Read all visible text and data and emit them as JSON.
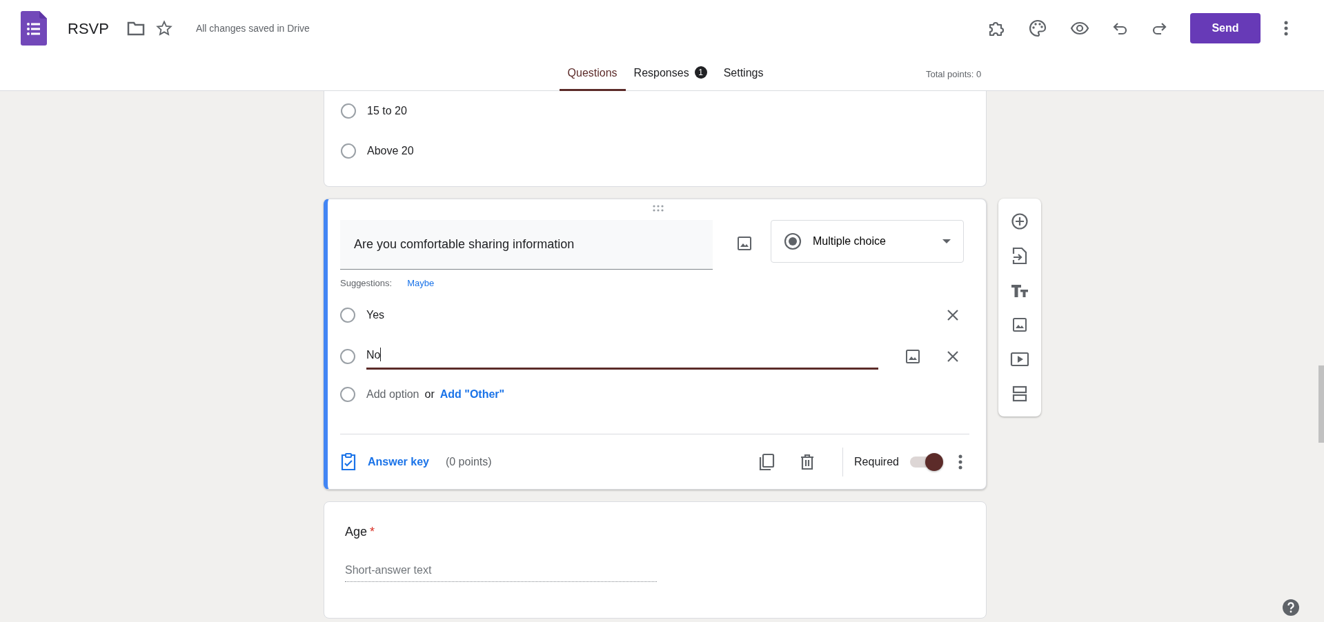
{
  "header": {
    "title": "RSVP",
    "save_status": "All changes saved in Drive",
    "send_label": "Send"
  },
  "tabs": [
    {
      "label": "Questions",
      "selected": true
    },
    {
      "label": "Responses",
      "selected": false,
      "badge": "1"
    },
    {
      "label": "Settings",
      "selected": false
    }
  ],
  "total_points": "Total points: 0",
  "previous_question": {
    "options": [
      {
        "label": "15 to 20",
        "selected": false
      },
      {
        "label": "Above 20",
        "selected": false
      }
    ]
  },
  "active_question": {
    "title": "Are you comfortable sharing information",
    "type": "Multiple choice",
    "suggestions_label": "Suggestions:",
    "suggestions": [
      "Maybe"
    ],
    "options": [
      {
        "label": "Yes",
        "focused": false,
        "selected": false
      },
      {
        "label": "No",
        "focused": true,
        "selected": false
      }
    ],
    "add_option": "Add option",
    "or": "or",
    "add_other": "Add \"Other\"",
    "answer_key": "Answer key",
    "points": "(0 points)",
    "required_label": "Required",
    "required": true
  },
  "next_question": {
    "title": "Age",
    "required": true,
    "required_mark": "*",
    "placeholder": "Short-answer text"
  }
}
